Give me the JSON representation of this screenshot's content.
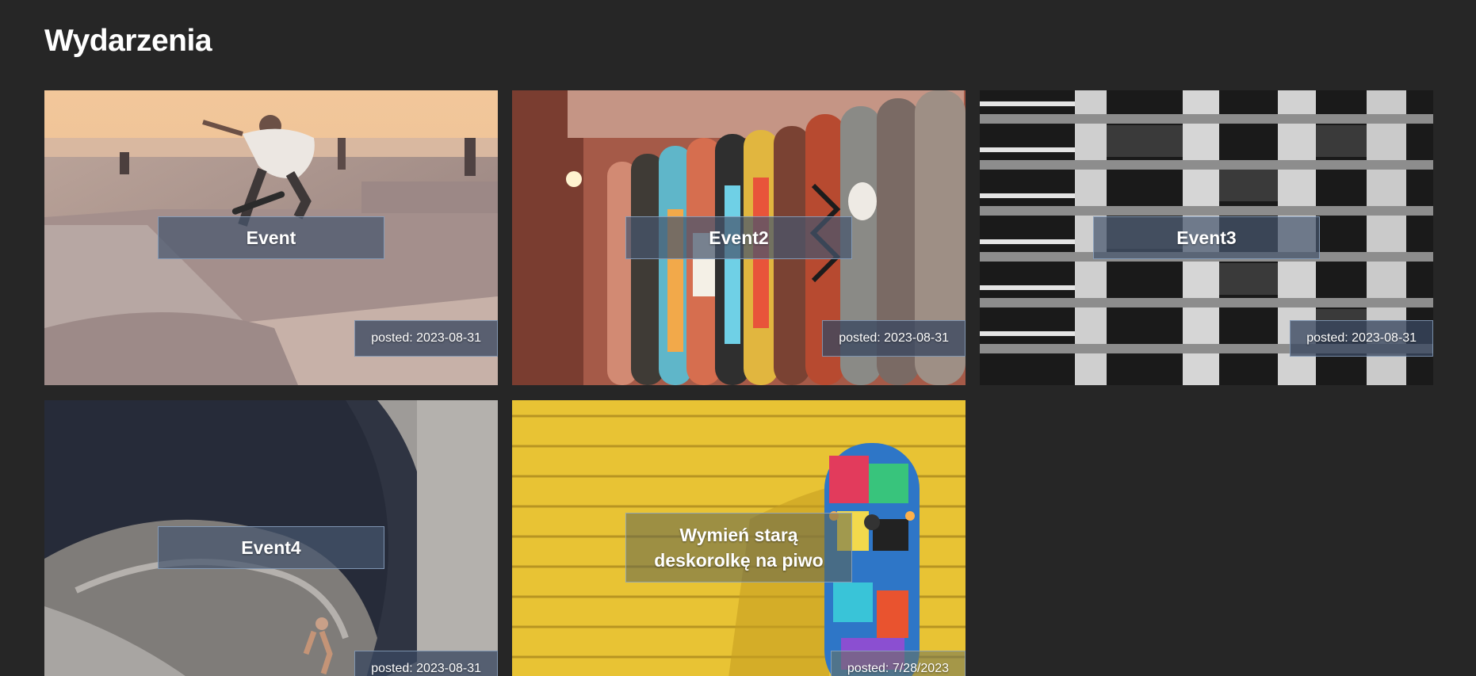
{
  "page": {
    "title": "Wydarzenia"
  },
  "events": [
    {
      "name": "Event",
      "date_label": "posted: 2023-08-31"
    },
    {
      "name": "Event2",
      "date_label": "posted: 2023-08-31"
    },
    {
      "name": "Event3",
      "date_label": "posted: 2023-08-31"
    },
    {
      "name": "Event4",
      "date_label": "posted: 2023-08-31"
    },
    {
      "name": "Wymień starą deskorolkę na piwo",
      "date_label": "posted: 7/28/2023"
    }
  ],
  "colors": {
    "background": "#262626",
    "overlay_box": "#46566e",
    "overlay_border": "#96afcd",
    "text": "#ffffff"
  }
}
